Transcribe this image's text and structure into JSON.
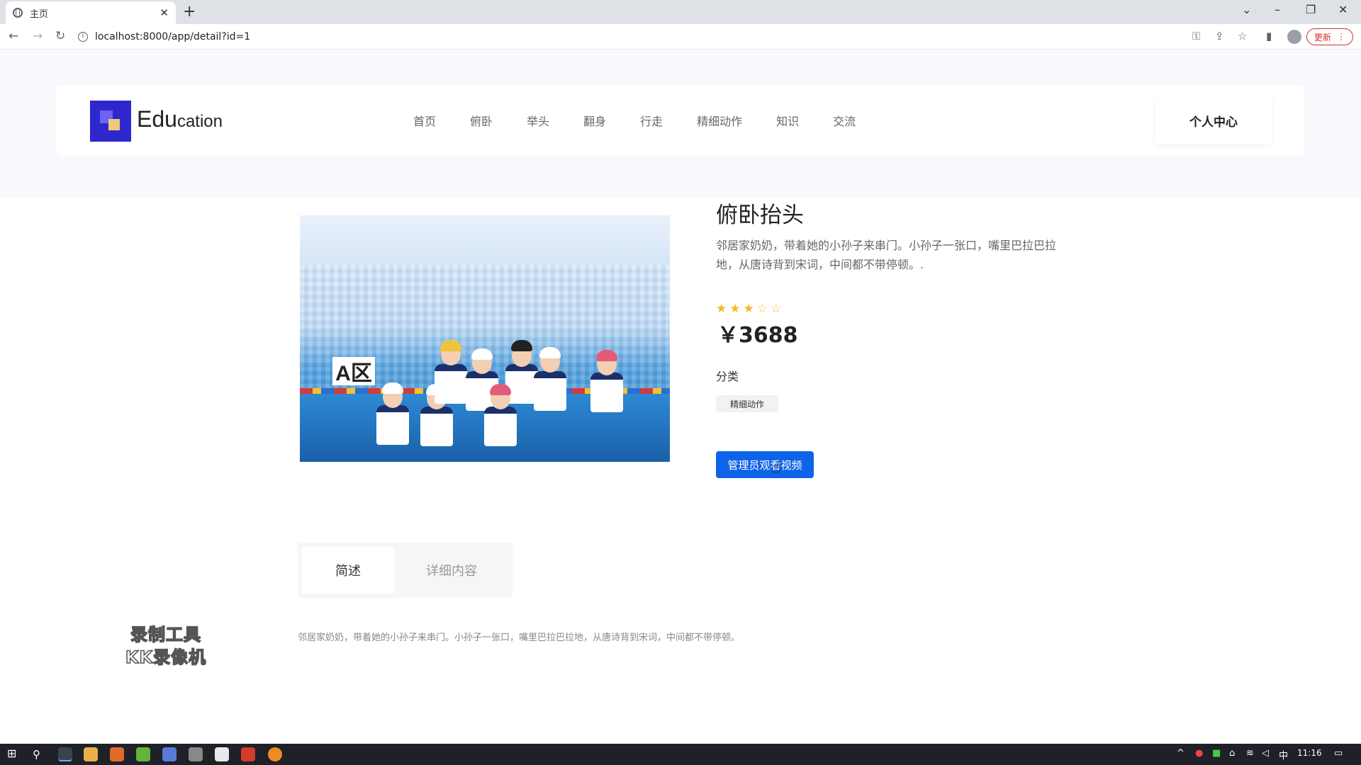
{
  "browser": {
    "tab_title": "主页",
    "url": "localhost:8000/app/detail?id=1",
    "update_label": "更新"
  },
  "site": {
    "logo_main": "Edu",
    "logo_rest": "cation",
    "nav": [
      "首页",
      "俯卧",
      "举头",
      "翻身",
      "行走",
      "精细动作",
      "知识",
      "交流"
    ],
    "personal_center": "个人中心"
  },
  "product": {
    "title": "俯卧抬头",
    "description": "邻居家奶奶，带着她的小孙子来串门。小孙子一张口，嘴里巴拉巴拉地，从唐诗背到宋词，中间都不带停顿。.",
    "rating": 3,
    "rating_max": 5,
    "price": "￥3688",
    "category_label": "分类",
    "category_tag": "精细动作",
    "watch_button": "管理员观看视频",
    "image_sign": "A区"
  },
  "tabs": {
    "summary": "简述",
    "detail": "详细内容"
  },
  "summary_text": "邻居家奶奶，带着她的小孙子来串门。小孙子一张口，嘴里巴拉巴拉地，从唐诗背到宋词，中间都不带停顿。",
  "watermark": {
    "line1": "录制工具",
    "line2": "KK录像机"
  },
  "taskbar": {
    "ime": "中",
    "time": "11:16"
  },
  "colors": {
    "primary_button": "#0d64e8",
    "star": "#f5b921",
    "logo": "#2f27ce"
  }
}
